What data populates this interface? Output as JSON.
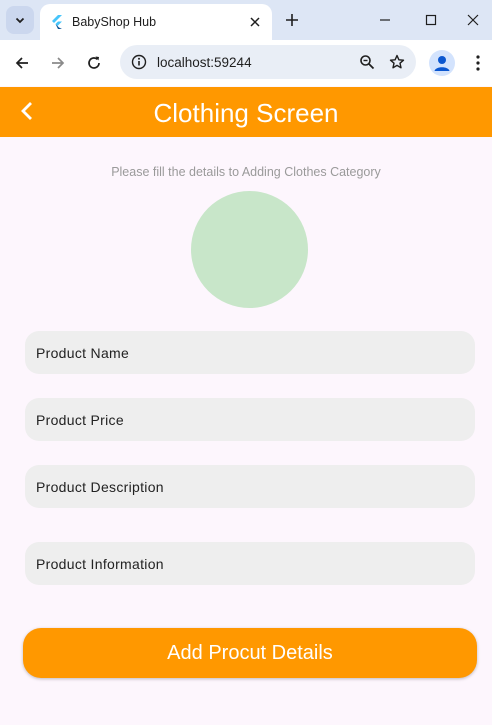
{
  "browser": {
    "tab_title": "BabyShop Hub",
    "url": "localhost:59244"
  },
  "app": {
    "title": "Clothing Screen",
    "subtitle": "Please fill the details to Adding Clothes Category",
    "image_placeholder_color": "#c8e6c9"
  },
  "form": {
    "fields": [
      {
        "placeholder": "Product Name"
      },
      {
        "placeholder": "Product Price"
      },
      {
        "placeholder": "Product Description"
      },
      {
        "placeholder": "Product Information"
      }
    ],
    "submit_label": "Add Procut Details"
  },
  "colors": {
    "accent": "#ff9800",
    "page_background": "#fdf6fd",
    "field_background": "#eeeeee"
  }
}
